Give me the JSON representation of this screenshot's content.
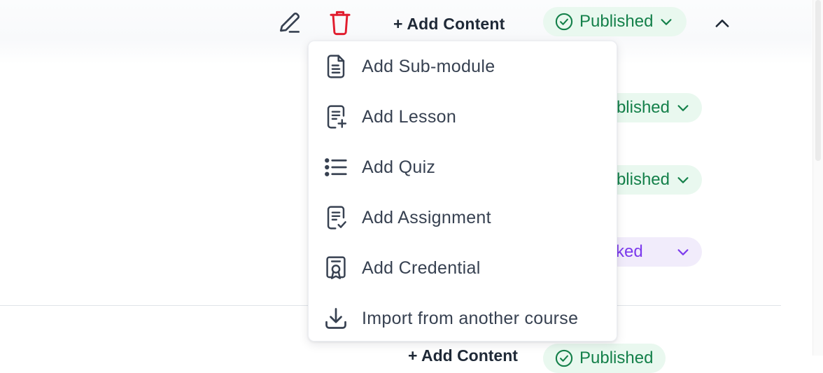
{
  "toolbar": {
    "add_content_label": "+ Add Content",
    "status_label": "Published",
    "edit_icon": "pencil-icon",
    "delete_icon": "trash-icon",
    "collapse_icon": "chevron-up-icon"
  },
  "rows": [
    {
      "status_label": "blished"
    },
    {
      "status_label": "blished"
    },
    {
      "status_label": "ked"
    }
  ],
  "bottom": {
    "add_content_label": "+ Add Content",
    "status_label": "Published"
  },
  "menu": {
    "items": [
      {
        "label": "Add Sub-module",
        "icon": "document-icon"
      },
      {
        "label": "Add Lesson",
        "icon": "document-plus-icon"
      },
      {
        "label": "Add Quiz",
        "icon": "list-icon"
      },
      {
        "label": "Add Assignment",
        "icon": "document-check-icon"
      },
      {
        "label": "Add Credential",
        "icon": "certificate-icon"
      },
      {
        "label": "Import from another course",
        "icon": "download-icon"
      }
    ]
  },
  "colors": {
    "published_text": "#14804a",
    "published_bg": "#e9f8ef",
    "locked_text": "#7c3aed",
    "locked_bg": "#f1ecfb",
    "delete_icon": "#e11d2e"
  }
}
